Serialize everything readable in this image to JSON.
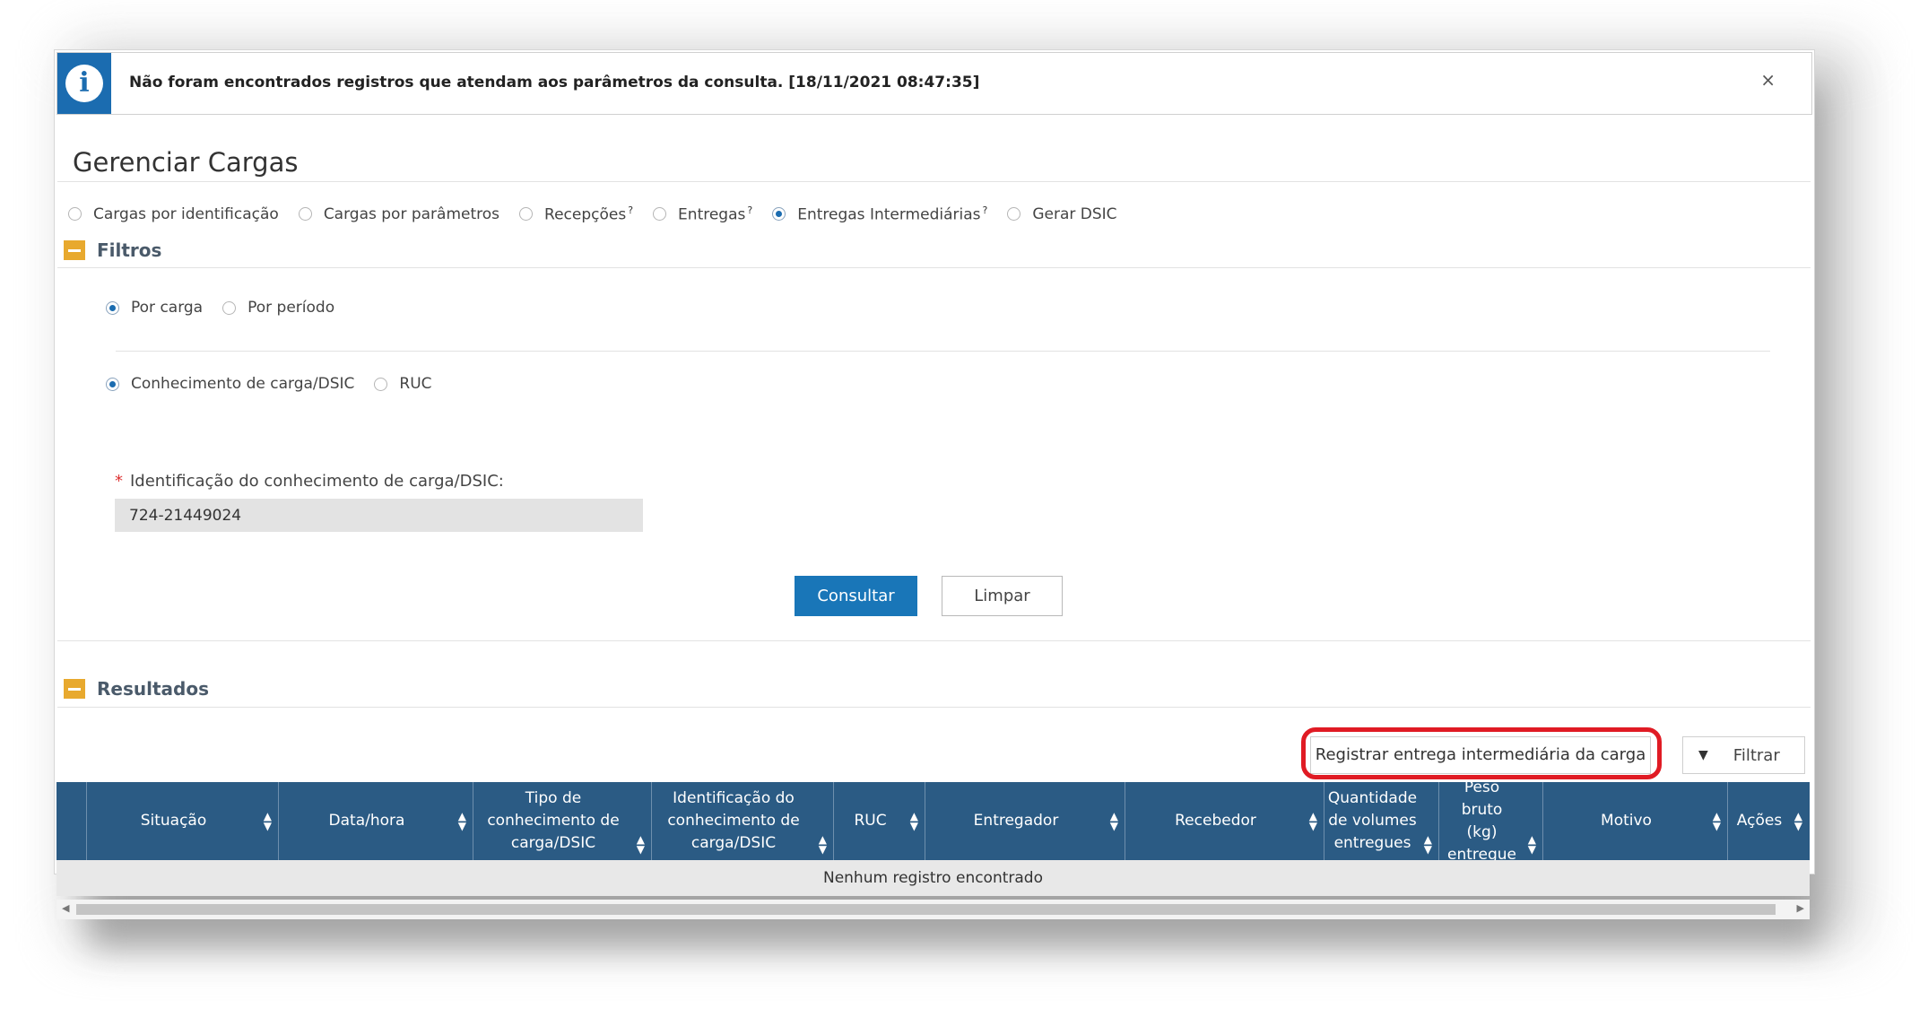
{
  "alert": {
    "message": "Não foram encontrados registros que atendam aos parâmetros da consulta. [18/11/2021 08:47:35]",
    "icon": "info-icon",
    "close_label": "×"
  },
  "page": {
    "title": "Gerenciar Cargas"
  },
  "modes": [
    {
      "label": "Cargas por identificação",
      "selected": false,
      "help": false
    },
    {
      "label": "Cargas por parâmetros",
      "selected": false,
      "help": false
    },
    {
      "label": "Recepções",
      "selected": false,
      "help": true
    },
    {
      "label": "Entregas",
      "selected": false,
      "help": true
    },
    {
      "label": "Entregas Intermediárias",
      "selected": true,
      "help": true
    },
    {
      "label": "Gerar DSIC",
      "selected": false,
      "help": false
    }
  ],
  "help_glyph": "?",
  "filters": {
    "title": "Filtros",
    "search_by": [
      {
        "label": "Por carga",
        "selected": true
      },
      {
        "label": "Por período",
        "selected": false
      }
    ],
    "doc_type": [
      {
        "label": "Conhecimento de carga/DSIC",
        "selected": true
      },
      {
        "label": "RUC",
        "selected": false
      }
    ],
    "required_mark": "*",
    "id_label": "Identificação do conhecimento de carga/DSIC:",
    "id_value": "724-21449024",
    "submit_label": "Consultar",
    "clear_label": "Limpar"
  },
  "results": {
    "title": "Resultados",
    "register_label": "Registrar entrega intermediária da carga",
    "filter_label": "Filtrar",
    "columns": [
      "Situação",
      "Data/hora",
      "Tipo de conhecimento de carga/DSIC",
      "Identificação do conhecimento de carga/DSIC",
      "RUC",
      "Entregador",
      "Recebedor",
      "Quantidade de volumes entregues",
      "Peso bruto (kg) entregue",
      "Motivo",
      "Ações"
    ],
    "empty_message": "Nenhum registro encontrado"
  },
  "colors": {
    "info": "#1b6cb0",
    "primary_button": "#1976b8",
    "table_header": "#2b5b84",
    "section_toggle": "#e8a92e",
    "highlight": "#e01b24"
  }
}
